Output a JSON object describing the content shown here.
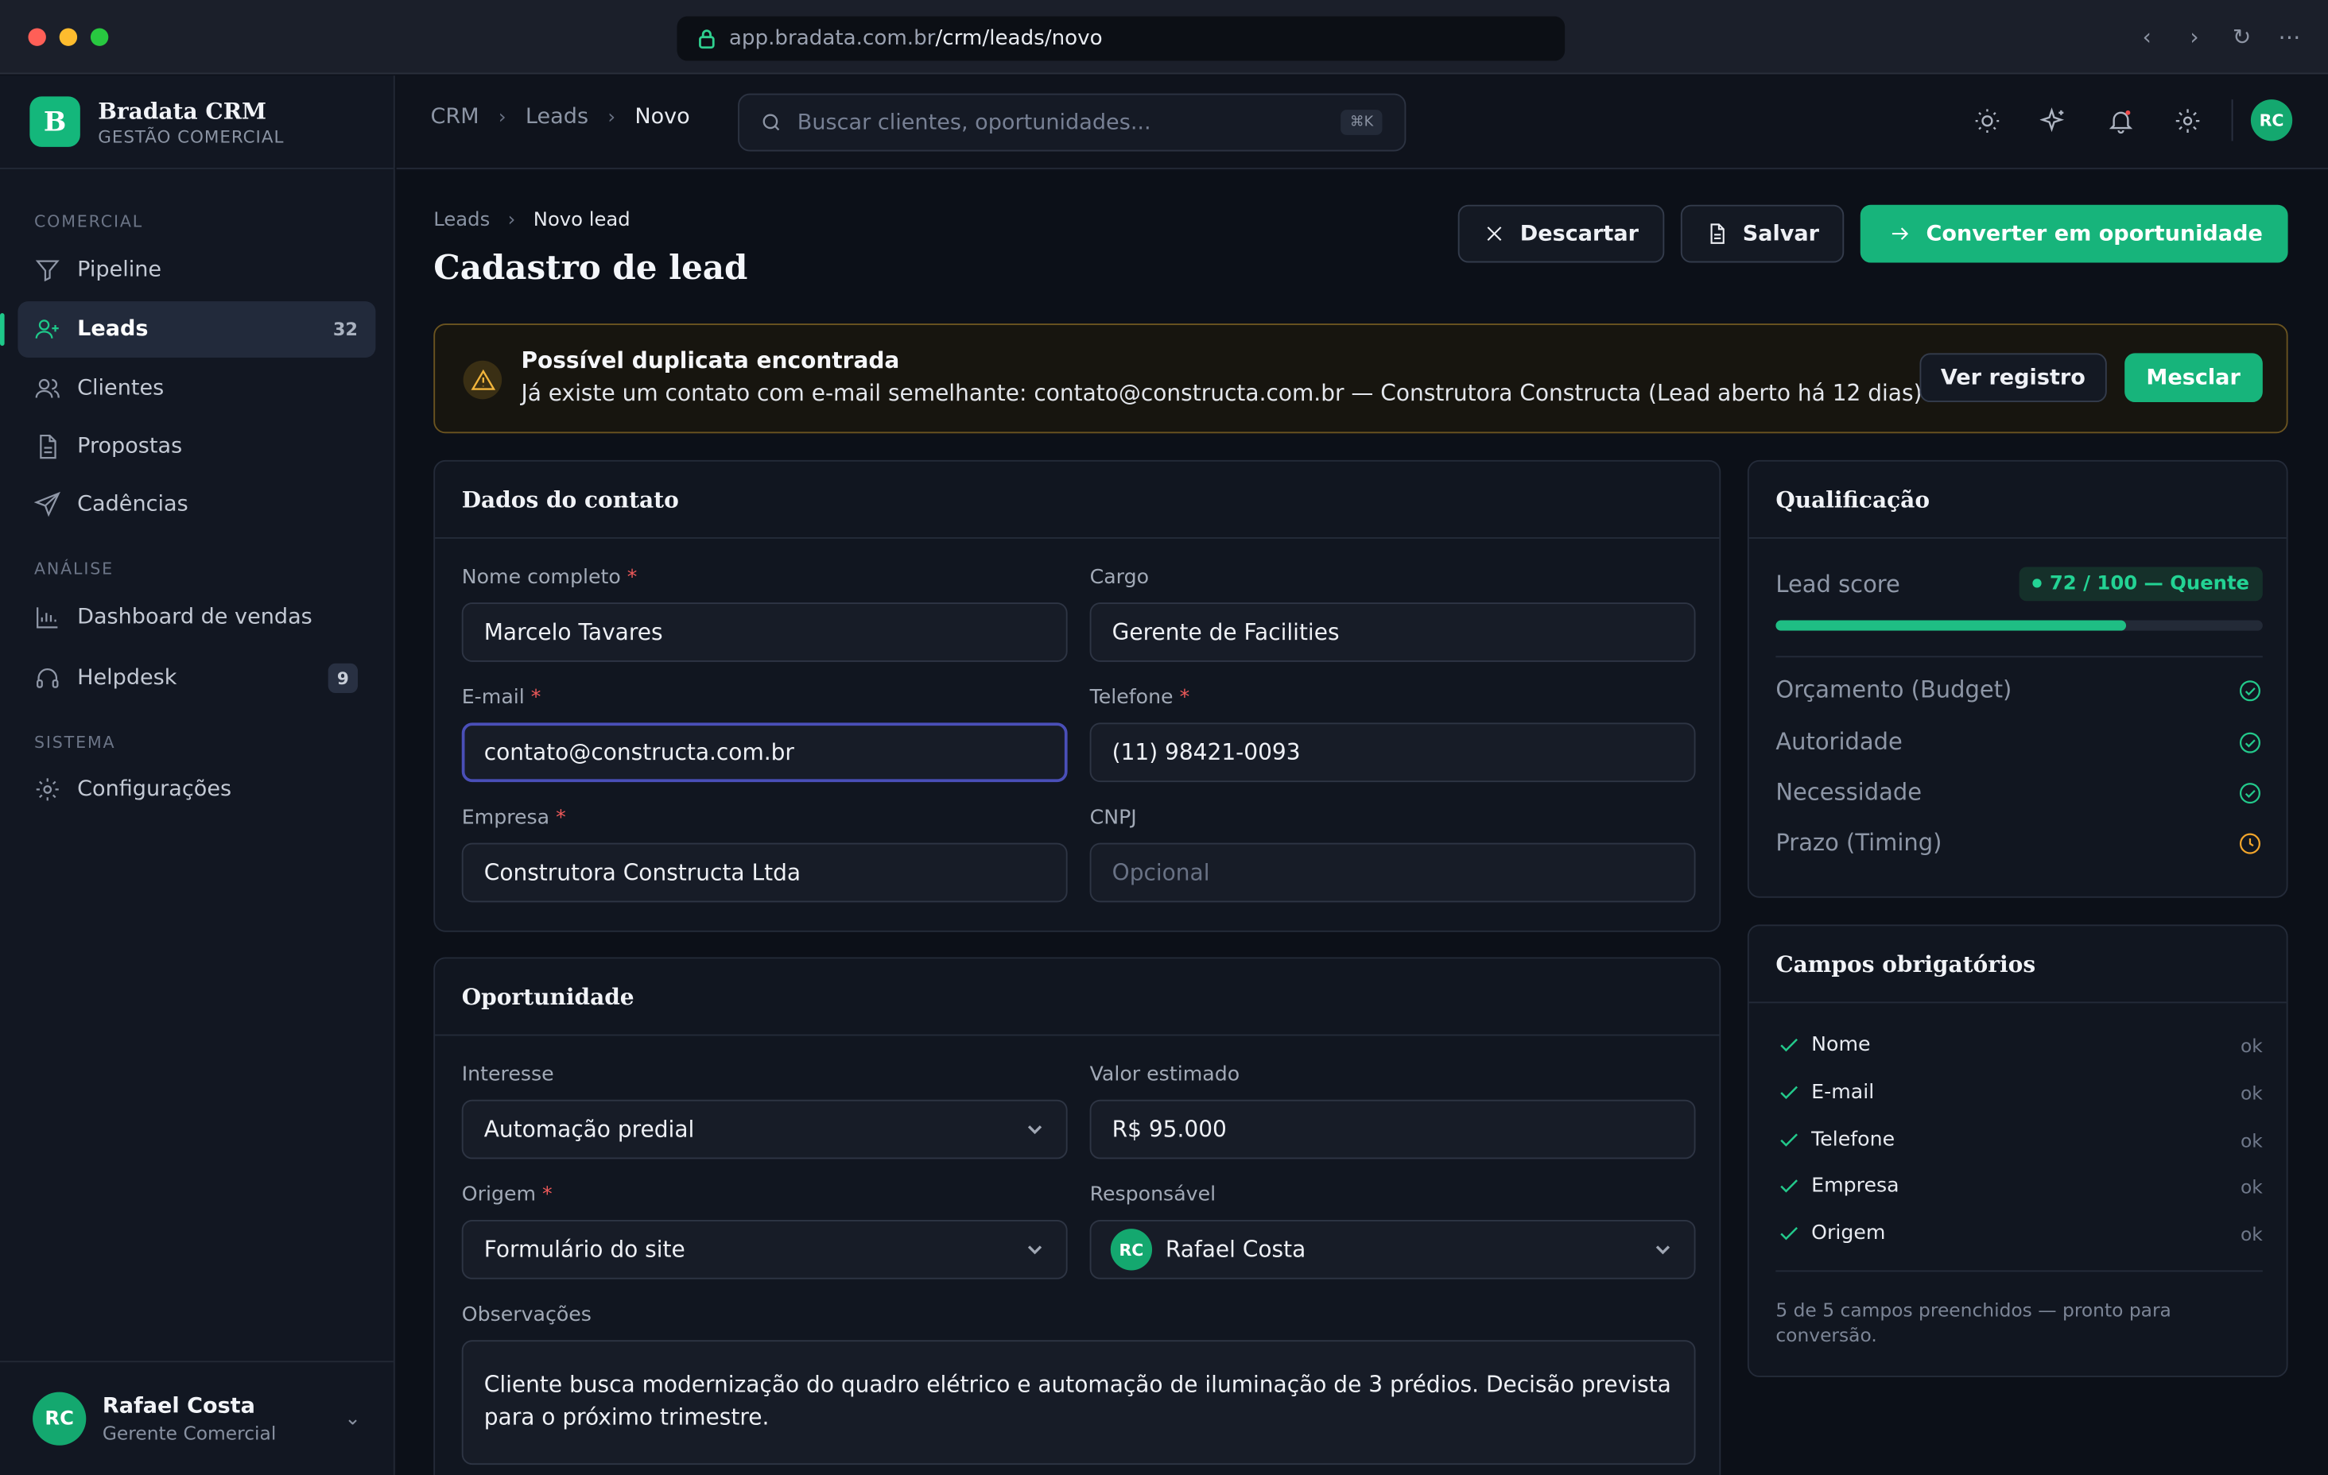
{
  "browser": {
    "url_domain": "app.bradata.com.br",
    "url_path": "/crm/leads/novo"
  },
  "brand": {
    "logo_letter": "B",
    "name": "Bradata CRM",
    "subtitle": "GESTÃO COMERCIAL"
  },
  "sidebar": {
    "sections": [
      {
        "title": "COMERCIAL"
      },
      {
        "title": "ANÁLISE"
      },
      {
        "title": "SISTEMA"
      }
    ],
    "items": [
      {
        "label": "Pipeline",
        "icon": "filter-icon"
      },
      {
        "label": "Leads",
        "icon": "user-plus-icon",
        "count": "32",
        "active": true
      },
      {
        "label": "Clientes",
        "icon": "users-icon"
      },
      {
        "label": "Propostas",
        "icon": "document-icon"
      },
      {
        "label": "Cadências",
        "icon": "send-icon"
      },
      {
        "label": "Dashboard de vendas",
        "icon": "bar-chart-icon"
      },
      {
        "label": "Helpdesk",
        "icon": "headset-icon",
        "count": "9"
      },
      {
        "label": "Configurações",
        "icon": "gear-icon"
      }
    ],
    "user": {
      "initials": "RC",
      "name": "Rafael Costa",
      "role": "Gerente Comercial"
    }
  },
  "topbar": {
    "breadcrumb": [
      "CRM",
      "Leads",
      "Novo"
    ],
    "search_placeholder": "Buscar clientes, oportunidades...",
    "search_shortcut": "⌘K",
    "avatar_initials": "RC"
  },
  "page": {
    "breadcrumb": [
      "Leads",
      "Novo lead"
    ],
    "title": "Cadastro de lead",
    "actions": {
      "discard": "Descartar",
      "save": "Salvar",
      "convert": "Converter em oportunidade"
    }
  },
  "alert": {
    "title": "Possível duplicata encontrada",
    "message": "Já existe um contato com e-mail semelhante: contato@constructa.com.br — Construtora Constructa (Lead aberto há 12 dias)",
    "view_label": "Ver registro",
    "merge_label": "Mesclar"
  },
  "contact": {
    "title": "Dados do contato",
    "name_label": "Nome completo",
    "name_value": "Marcelo Tavares",
    "role_label": "Cargo",
    "role_value": "Gerente de Facilities",
    "email_label": "E-mail",
    "email_value": "contato@constructa.com.br",
    "phone_label": "Telefone",
    "phone_value": "(11) 98421-0093",
    "company_label": "Empresa",
    "company_value": "Construtora Constructa Ltda",
    "cnpj_label": "CNPJ",
    "cnpj_placeholder": "Opcional",
    "required_mark": "*"
  },
  "opportunity": {
    "title": "Oportunidade",
    "interest_label": "Interesse",
    "interest_value": "Automação predial",
    "value_label": "Valor estimado",
    "value_value": "R$ 95.000",
    "origin_label": "Origem",
    "origin_value": "Formulário do site",
    "owner_label": "Responsável",
    "owner_initials": "RC",
    "owner_value": "Rafael Costa",
    "notes_label": "Observações",
    "notes_value": "Cliente busca modernização do quadro elétrico e automação de iluminação de 3 prédios. Decisão prevista para o próximo trimestre."
  },
  "qualification": {
    "title": "Qualificação",
    "score_label": "Lead score",
    "score_text": "72 / 100 — Quente",
    "score_fraction": 0.72,
    "accent": "#1fbe84",
    "criteria": [
      {
        "label": "Orçamento (Budget)",
        "status": "check-circle-icon"
      },
      {
        "label": "Autoridade",
        "status": "check-circle-icon"
      },
      {
        "label": "Necessidade",
        "status": "check-circle-icon"
      },
      {
        "label": "Prazo (Timing)",
        "status": "clock-icon"
      }
    ]
  },
  "required_fields": {
    "title": "Campos obrigatórios",
    "items": [
      {
        "label": "Nome",
        "status": "ok"
      },
      {
        "label": "E-mail",
        "status": "ok"
      },
      {
        "label": "Telefone",
        "status": "ok"
      },
      {
        "label": "Empresa",
        "status": "ok"
      },
      {
        "label": "Origem",
        "status": "ok"
      }
    ],
    "summary": "5 de 5 campos preenchidos — pronto para conversão."
  }
}
